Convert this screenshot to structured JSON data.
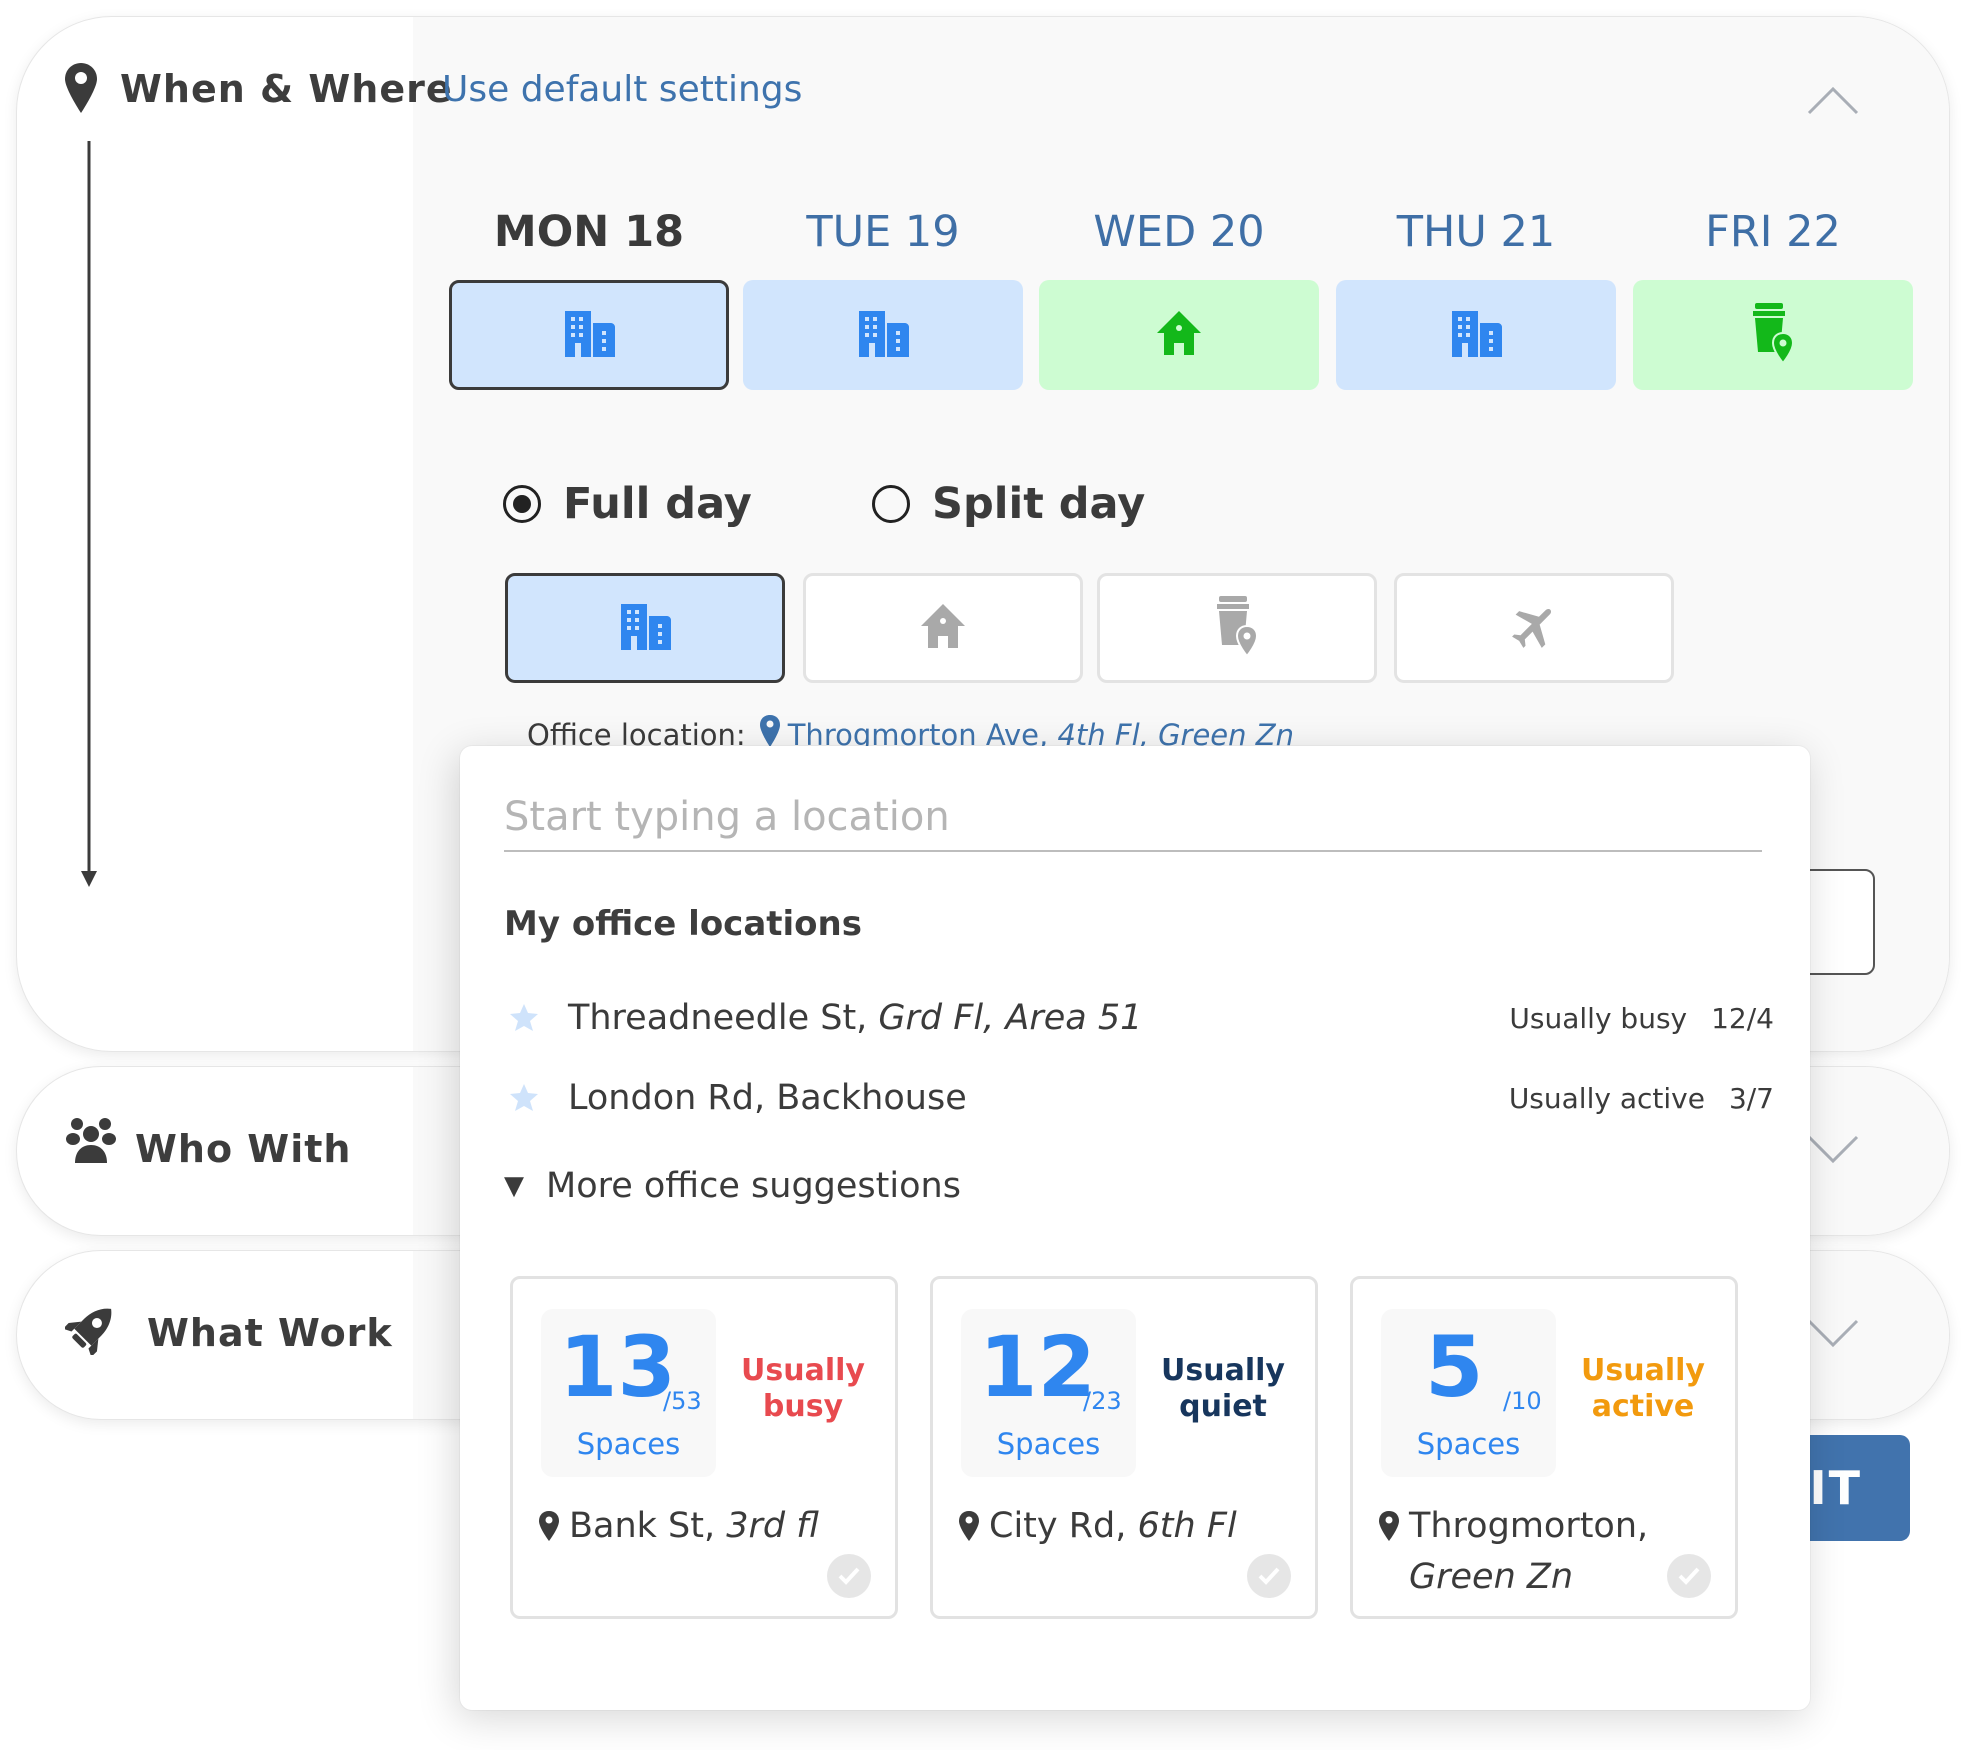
{
  "sections": {
    "where": {
      "title": "When & Where",
      "default_link": "Use default settings",
      "days": [
        {
          "label": "MON 18",
          "type": "office",
          "selected": true
        },
        {
          "label": "TUE 19",
          "type": "office",
          "selected": false
        },
        {
          "label": "WED 20",
          "type": "home",
          "selected": false
        },
        {
          "label": "THU 21",
          "type": "office",
          "selected": false
        },
        {
          "label": "FRI 22",
          "type": "other",
          "selected": false
        }
      ],
      "day_mode": {
        "options": [
          "Full day",
          "Split day"
        ],
        "selected": "Full day"
      },
      "work_modes": [
        {
          "icon": "office-building-icon",
          "selected": true
        },
        {
          "icon": "home-icon",
          "selected": false
        },
        {
          "icon": "coffee-location-icon",
          "selected": false
        },
        {
          "icon": "airplane-icon",
          "selected": false
        }
      ],
      "office_location": {
        "label": "Office location:",
        "street": "Throgmorton Ave, ",
        "detail": "4th Fl, Green Zn"
      }
    },
    "who": {
      "title": "Who With"
    },
    "what": {
      "title": "What Work"
    }
  },
  "submit": {
    "label": "SUBMIT",
    "visible_text": "IT"
  },
  "popup": {
    "search": {
      "placeholder": "Start typing a location",
      "value": ""
    },
    "my_locations_heading": "My office locations",
    "my_locations": [
      {
        "street": "Threadneedle St, ",
        "detail": "Grd Fl, Area 51",
        "status": "Usually busy",
        "count": "12/4"
      },
      {
        "street": "London Rd, Backhouse",
        "detail": "",
        "status": "Usually active",
        "count": "3/7"
      }
    ],
    "more_label": "More office suggestions",
    "suggestions": [
      {
        "available": "13",
        "total": "/53",
        "unit": "Spaces",
        "status_line1": "Usually",
        "status_line2": "busy",
        "status_color": "#e84a4f",
        "street": "Bank St, ",
        "detail": "3rd fl"
      },
      {
        "available": "12",
        "total": "/23",
        "unit": "Spaces",
        "status_line1": "Usually",
        "status_line2": "quiet",
        "status_color": "#17365d",
        "street": "City Rd, ",
        "detail": "6th Fl"
      },
      {
        "available": "5",
        "total": "/10",
        "unit": "Spaces",
        "status_line1": "Usually",
        "status_line2": "active",
        "status_color": "#f29a0e",
        "street": "Throgmorton,",
        "detail": "Green Zn"
      }
    ]
  },
  "colors": {
    "office_tile": "#d1e5fd",
    "home_tile": "#cdfcd2",
    "office_icon": "#2f86ef",
    "home_icon": "#13b81a",
    "link": "#3e73ad",
    "submit": "#4173ad"
  }
}
